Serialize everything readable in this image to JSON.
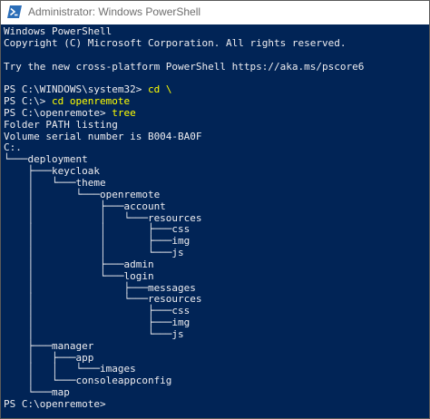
{
  "window": {
    "title": "Administrator: Windows PowerShell"
  },
  "icons": {
    "app_icon": "powershell-icon"
  },
  "colors": {
    "console_background": "#012456",
    "console_text": "#eeedf0",
    "command_text": "#ffff00",
    "titlebar_text": "#6e6e6e"
  },
  "console": {
    "lines": [
      {
        "text": "Windows PowerShell"
      },
      {
        "text": "Copyright (C) Microsoft Corporation. All rights reserved."
      },
      {
        "text": ""
      },
      {
        "text": "Try the new cross-platform PowerShell https://aka.ms/pscore6"
      },
      {
        "text": ""
      },
      {
        "prompt": "PS C:\\WINDOWS\\system32> ",
        "command": "cd \\"
      },
      {
        "prompt": "PS C:\\> ",
        "command": "cd openremote"
      },
      {
        "prompt": "PS C:\\openremote> ",
        "command": "tree"
      },
      {
        "text": "Folder PATH listing"
      },
      {
        "text": "Volume serial number is B004-BA0F"
      },
      {
        "text": "C:."
      },
      {
        "text": "└───deployment"
      },
      {
        "text": "    ├───keycloak"
      },
      {
        "text": "    │   └───theme"
      },
      {
        "text": "    │       └───openremote"
      },
      {
        "text": "    │           ├───account"
      },
      {
        "text": "    │           │   └───resources"
      },
      {
        "text": "    │           │       ├───css"
      },
      {
        "text": "    │           │       ├───img"
      },
      {
        "text": "    │           │       └───js"
      },
      {
        "text": "    │           ├───admin"
      },
      {
        "text": "    │           └───login"
      },
      {
        "text": "    │               ├───messages"
      },
      {
        "text": "    │               └───resources"
      },
      {
        "text": "    │                   ├───css"
      },
      {
        "text": "    │                   ├───img"
      },
      {
        "text": "    │                   └───js"
      },
      {
        "text": "    ├───manager"
      },
      {
        "text": "    │   ├───app"
      },
      {
        "text": "    │   │   └───images"
      },
      {
        "text": "    │   └───consoleappconfig"
      },
      {
        "text": "    └───map"
      },
      {
        "prompt": "PS C:\\openremote> ",
        "command": ""
      }
    ]
  }
}
